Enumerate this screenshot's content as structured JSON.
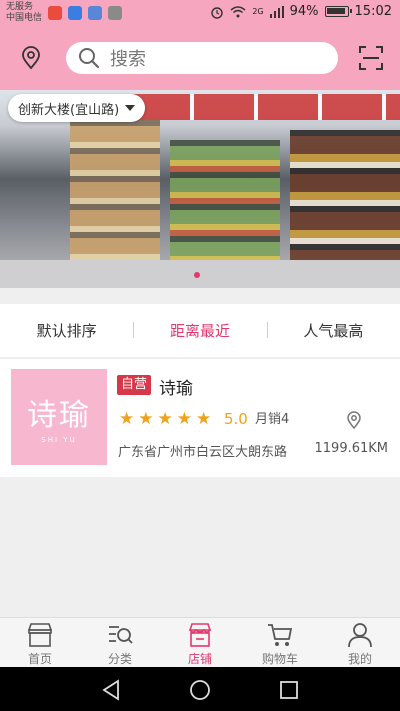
{
  "status_bar": {
    "carrier_line1": "无服务",
    "carrier_line2": "中国电信",
    "network": "2G",
    "battery": "94%",
    "time": "15:02"
  },
  "header": {
    "search_placeholder": "搜索",
    "location_label": "创新大楼(宜山路)"
  },
  "sort_tabs": [
    {
      "label": "默认排序",
      "active": false
    },
    {
      "label": "距离最近",
      "active": true
    },
    {
      "label": "人气最高",
      "active": false
    }
  ],
  "store": {
    "badge": "自营",
    "name": "诗瑜",
    "logo_text_cn": "诗瑜",
    "logo_text_en": "SHI YU",
    "stars": 5,
    "rating": "5.0",
    "sales": "月销4",
    "address": "广东省广州市白云区大朗东路",
    "distance": "1199.61KM"
  },
  "tabs": [
    {
      "label": "首页",
      "icon": "shop-icon",
      "active": false
    },
    {
      "label": "分类",
      "icon": "category-search-icon",
      "active": false
    },
    {
      "label": "店铺",
      "icon": "store-icon",
      "active": true
    },
    {
      "label": "购物车",
      "icon": "cart-icon",
      "active": false
    },
    {
      "label": "我的",
      "icon": "user-icon",
      "active": false
    }
  ],
  "colors": {
    "header": "#f6a6bf",
    "accent": "#e2386e",
    "star": "#f2a21a",
    "badge": "#d6374a"
  }
}
